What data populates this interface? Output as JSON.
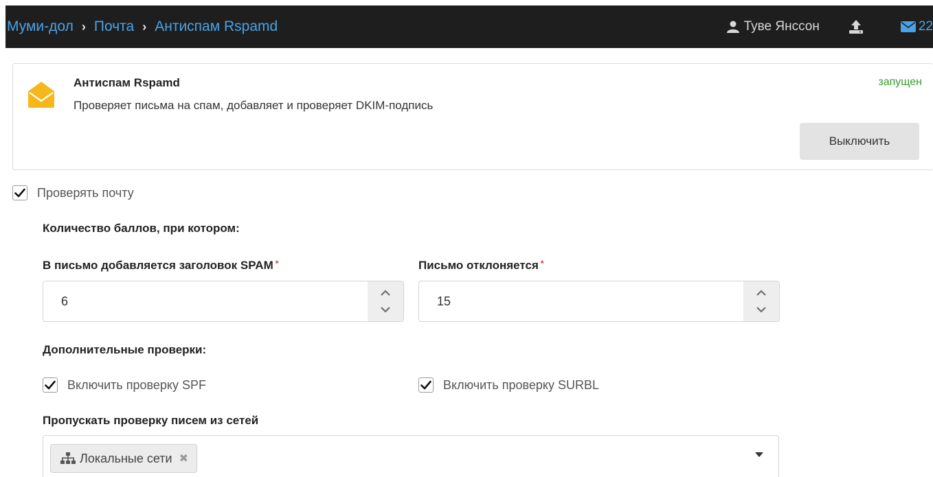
{
  "breadcrumb": {
    "items": [
      "Муми-дол",
      "Почта",
      "Антиспам Rspamd"
    ]
  },
  "header": {
    "user_name": "Туве Янссон",
    "mail_count": "22"
  },
  "service": {
    "title": "Антиспам Rspamd",
    "description": "Проверяет письма на спам, добавляет и проверяет DKIM-подпись",
    "status": "запущен",
    "status_color": "#3a9a2d",
    "disable_label": "Выключить"
  },
  "form": {
    "check_mail_label": "Проверять почту",
    "check_mail_checked": true,
    "score_heading": "Количество баллов, при котором:",
    "spam_header_label": "В письмо добавляется заголовок SPAM",
    "spam_header_value": "6",
    "reject_label": "Письмо отклоняется",
    "reject_value": "15",
    "extra_heading": "Дополнительные проверки:",
    "spf_label": "Включить проверку SPF",
    "spf_checked": true,
    "surbl_label": "Включить проверку SURBL",
    "surbl_checked": true,
    "skip_networks_label": "Пропускать проверку писем из сетей",
    "skip_networks_tags": [
      "Локальные сети"
    ]
  },
  "colors": {
    "accent": "#4aa3e8",
    "topbar": "#1e1e1e",
    "icon_yellow": "#f5b81c",
    "required": "#d9343e"
  }
}
